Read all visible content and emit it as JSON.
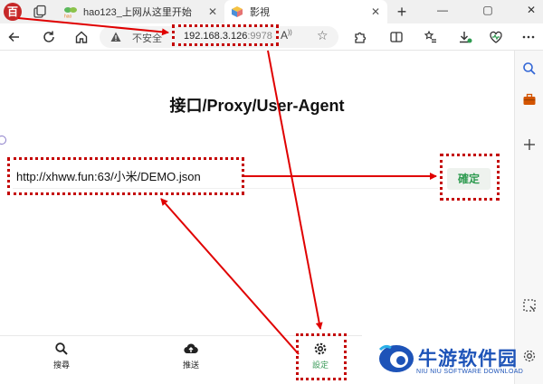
{
  "browser": {
    "tabs": [
      {
        "label": "hao123_上网从这里开始",
        "favicon": "hao123-icon",
        "active": false
      },
      {
        "label": "影視",
        "favicon": "cube-icon",
        "active": true
      }
    ],
    "app_icon_glyph": "百",
    "new_tab_glyph": "+",
    "window_controls": [
      "—",
      "▢",
      "✕"
    ],
    "address_bar": {
      "insecure_label": "不安全",
      "url_host": "192.168.3.126",
      "url_port": ":9978"
    }
  },
  "page": {
    "title": "接口/Proxy/User-Agent",
    "proxy_input_value": "http://xhww.fun:63/小米/DEMO.json",
    "confirm_label": "確定",
    "nav": [
      {
        "label": "搜尋",
        "icon": "search-icon",
        "active": false
      },
      {
        "label": "推送",
        "icon": "cloud-upload-icon",
        "active": false
      },
      {
        "label": "設定",
        "icon": "gear-icon",
        "active": true
      }
    ],
    "accent_color": "#3a9a58"
  },
  "watermark": {
    "name": "牛游软件园",
    "subtitle": "NIU NIU SOFTWARE DOWNLOAD"
  },
  "annotation_color": "#c40000"
}
